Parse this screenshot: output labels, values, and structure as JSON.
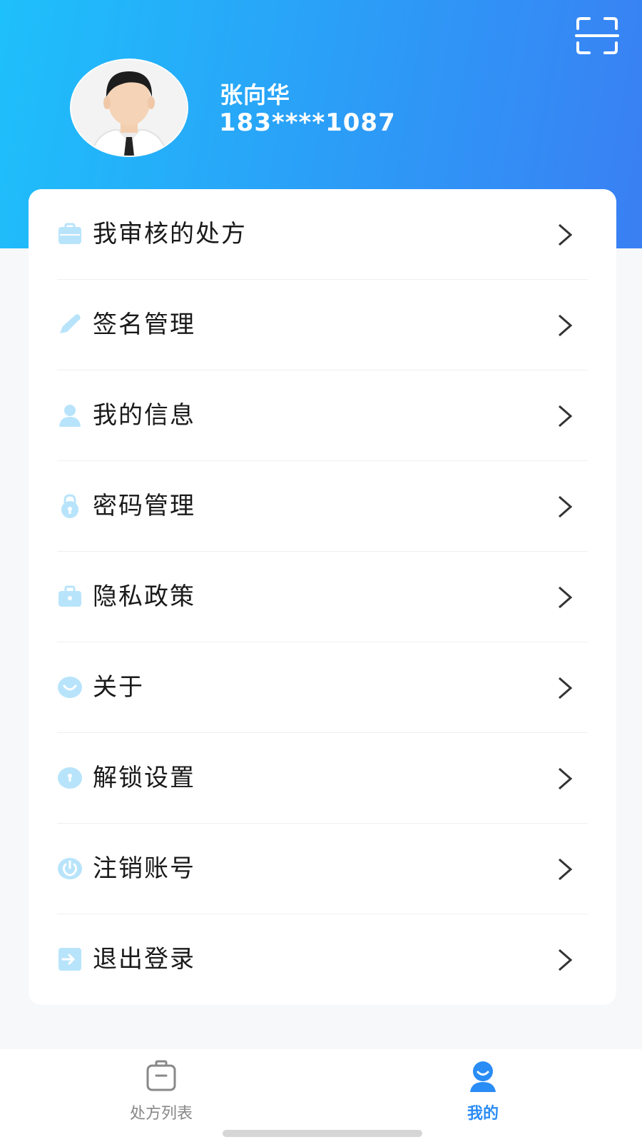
{
  "header": {
    "user_name": "张向华",
    "user_phone": "183****1087",
    "scan_icon": "scan-icon"
  },
  "menu": {
    "items": [
      {
        "label": "我审核的处方",
        "icon": "briefcase-icon"
      },
      {
        "label": "签名管理",
        "icon": "pen-icon"
      },
      {
        "label": "我的信息",
        "icon": "person-icon"
      },
      {
        "label": "密码管理",
        "icon": "lock-icon"
      },
      {
        "label": "隐私政策",
        "icon": "shield-bag-icon"
      },
      {
        "label": "关于",
        "icon": "smile-icon"
      },
      {
        "label": "解锁设置",
        "icon": "unlock-icon"
      },
      {
        "label": "注销账号",
        "icon": "power-icon"
      },
      {
        "label": "退出登录",
        "icon": "logout-icon"
      }
    ]
  },
  "tabbar": {
    "tabs": [
      {
        "label": "处方列表",
        "icon": "clipboard-icon",
        "active": false
      },
      {
        "label": "我的",
        "icon": "user-icon",
        "active": true
      }
    ]
  },
  "colors": {
    "header_gradient_start": "#1ec0fb",
    "header_gradient_end": "#3a7ff3",
    "icon_light_blue": "#b8e4fb",
    "active_tab": "#2a8cf5",
    "inactive_tab": "#888888"
  }
}
